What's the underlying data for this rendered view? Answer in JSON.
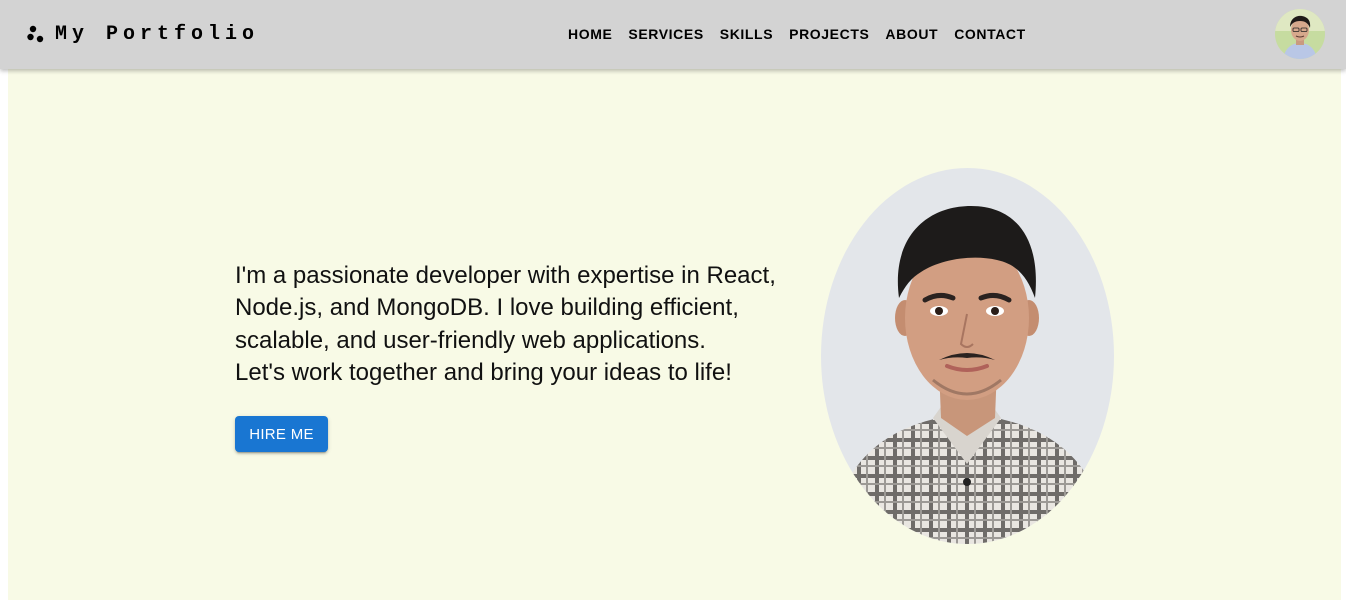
{
  "header": {
    "logo_text": "My Portfolio",
    "logo_icon": "three-dots-icon",
    "nav": [
      {
        "label": "HOME"
      },
      {
        "label": "SERVICES"
      },
      {
        "label": "SKILLS"
      },
      {
        "label": "PROJECTS"
      },
      {
        "label": "ABOUT"
      },
      {
        "label": "CONTACT"
      }
    ],
    "avatar_icon": "profile-avatar"
  },
  "hero": {
    "intro_lines": [
      "I'm a passionate developer with expertise in React,",
      "Node.js, and MongoDB. I love building efficient,",
      "scalable, and user-friendly web applications.",
      "Let's work together and bring your ideas to life!"
    ],
    "cta_label": "HIRE ME",
    "portrait_icon": "profile-photo"
  },
  "colors": {
    "appbar": "#d3d3d3",
    "hero_bg": "#f8fae6",
    "button": "#1976d2"
  }
}
